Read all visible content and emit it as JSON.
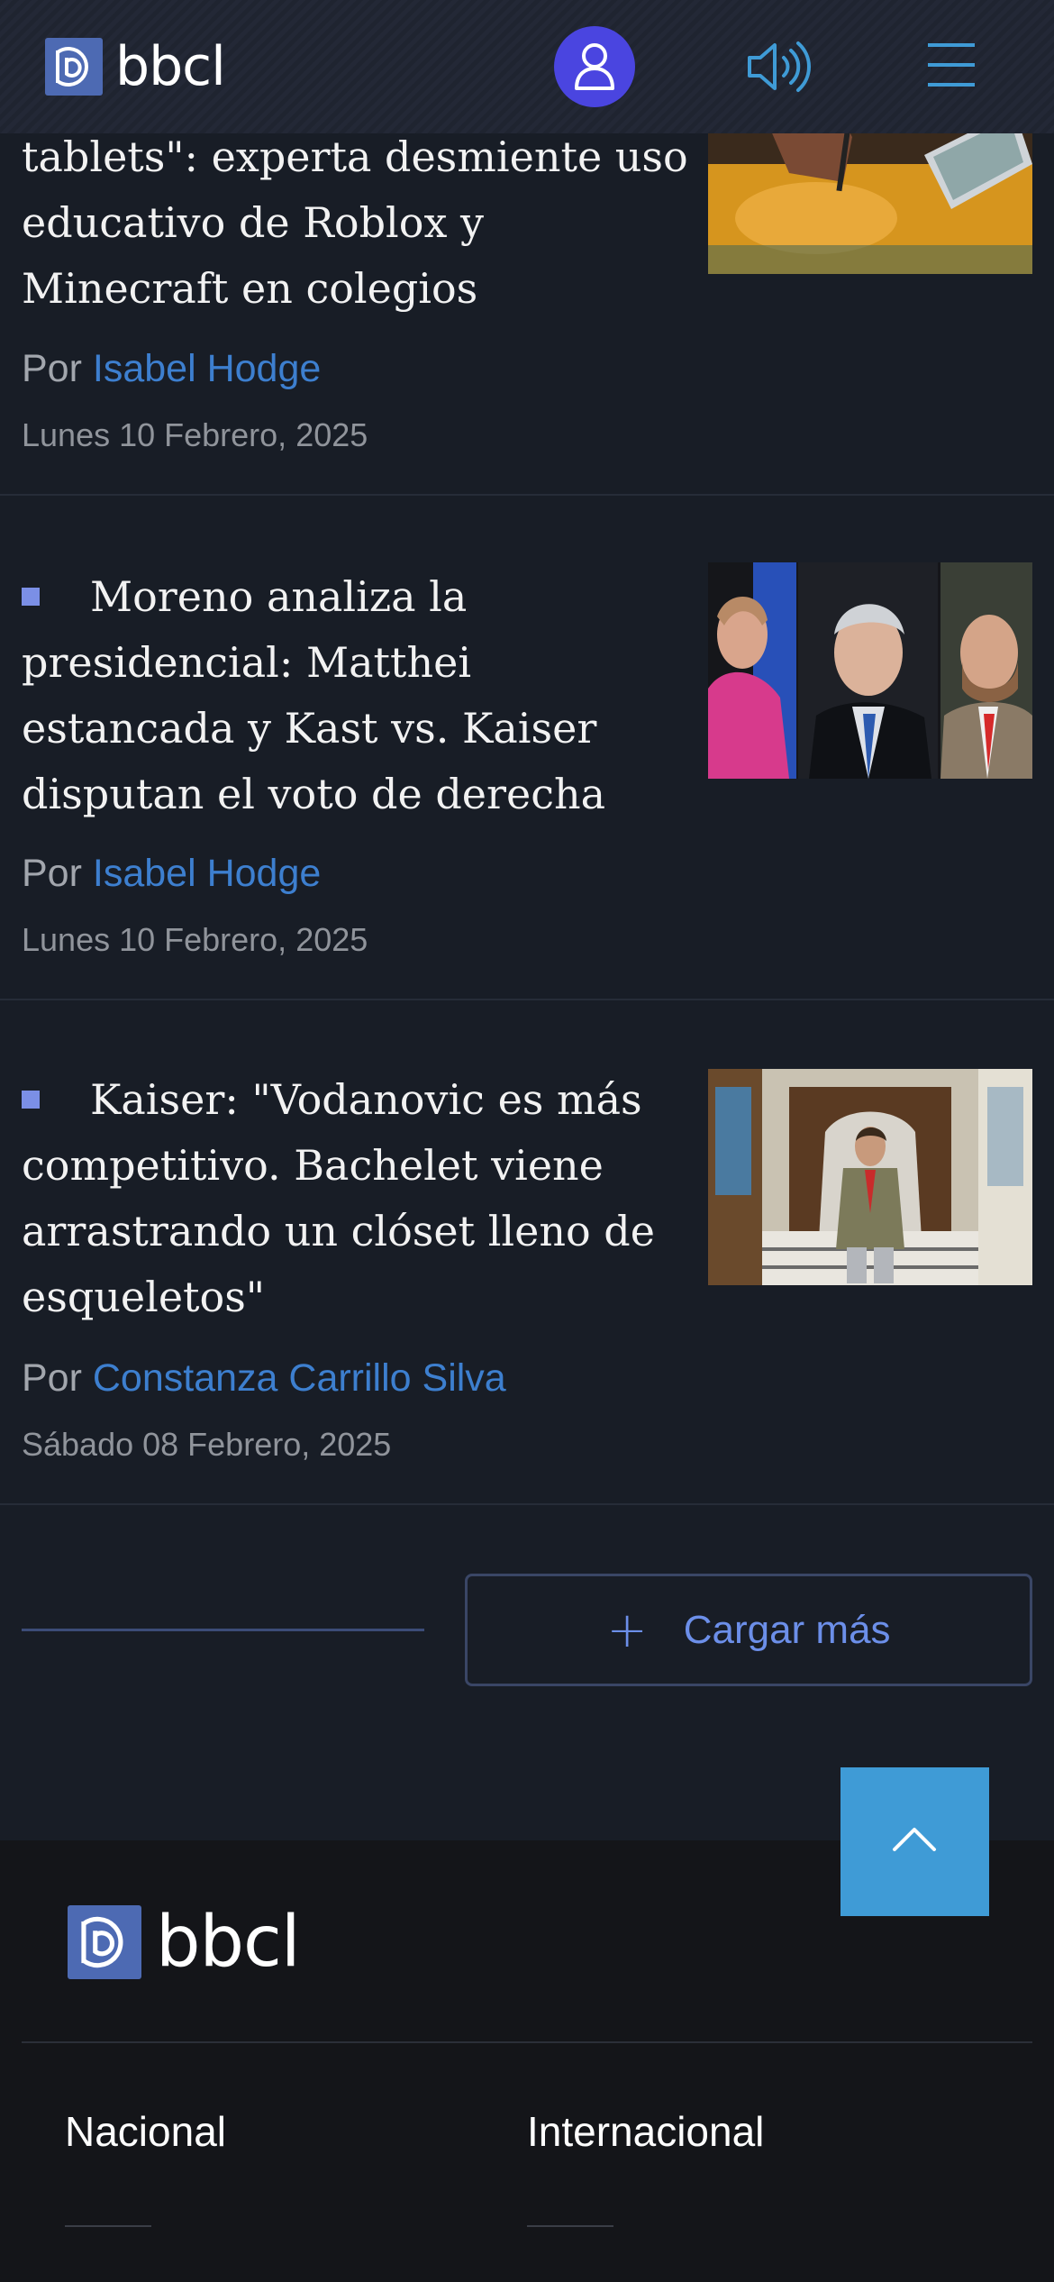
{
  "header": {
    "logo_text": "bbcl",
    "icons": {
      "user": "user-icon",
      "audio": "speaker-icon",
      "menu": "hamburger-menu-icon"
    },
    "colors": {
      "user_button": "#4a45e0",
      "audio_icon": "#3f9bd6",
      "menu_icon": "#3f9bd6"
    }
  },
  "articles": [
    {
      "title": "tablets\": experta desmiente uso educativo de Roblox y Minecraft en colegios",
      "author_prefix": "Por",
      "author": "Isabel Hodge",
      "date": "Lunes 10 Febrero, 2025"
    },
    {
      "title": "Moreno analiza la presidencial: Matthei estancada y Kast vs. Kaiser disputan el voto de derecha",
      "author_prefix": "Por",
      "author": "Isabel Hodge",
      "date": "Lunes 10 Febrero, 2025"
    },
    {
      "title": "Kaiser: \"Vodanovic es más competitivo. Bachelet viene arrastrando un clóset lleno de esqueletos\"",
      "author_prefix": "Por",
      "author": "Constanza Carrillo Silva",
      "date": "Sábado 08 Febrero, 2025"
    }
  ],
  "load_more": {
    "label": "Cargar más",
    "icon": "plus-icon"
  },
  "scroll_top": {
    "icon": "chevron-up-icon",
    "color": "#3f9bd6"
  },
  "footer": {
    "logo_text": "bbcl",
    "links": [
      "Nacional",
      "Internacional"
    ]
  },
  "colors": {
    "background": "#181d26",
    "footer_background": "#141519",
    "author_link": "#3d7fcf",
    "accent": "#6c8fe9"
  }
}
